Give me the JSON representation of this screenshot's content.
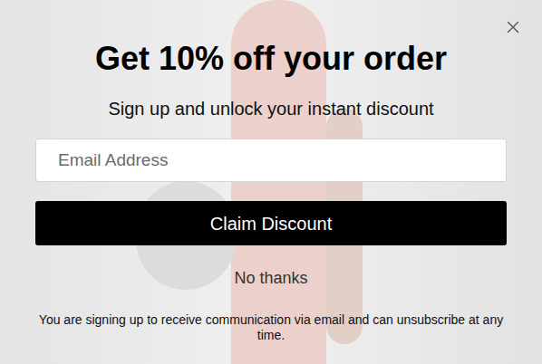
{
  "popup": {
    "title": "Get 10% off your order",
    "subtitle": "Sign up and unlock your instant discount",
    "email": {
      "placeholder": "Email Address"
    },
    "submit": "Claim Discount",
    "decline": "No thanks",
    "disclaimer": "You are signing up to receive communication via email and can unsubscribe at any time."
  }
}
